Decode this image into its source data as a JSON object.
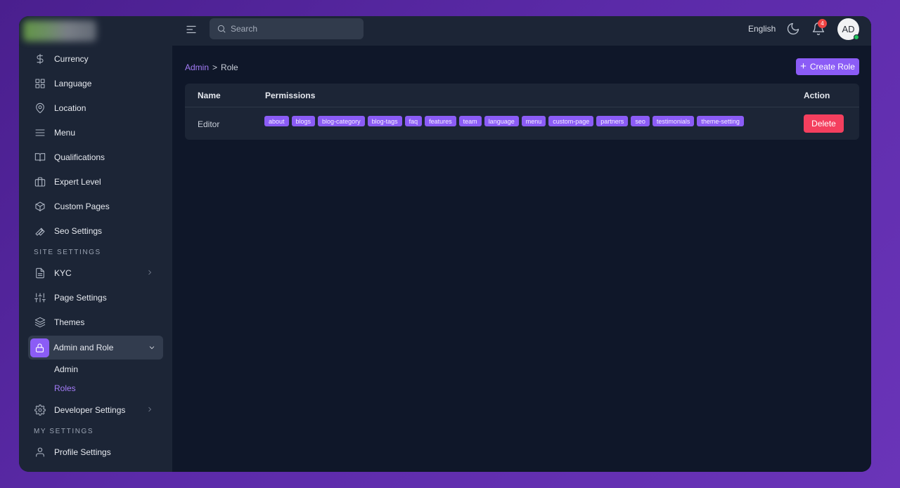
{
  "sidebar": {
    "items": [
      {
        "label": "Currency",
        "icon": "dollar-icon"
      },
      {
        "label": "Language",
        "icon": "grid-icon"
      },
      {
        "label": "Location",
        "icon": "map-pin-icon"
      },
      {
        "label": "Menu",
        "icon": "menu-icon"
      },
      {
        "label": "Qualifications",
        "icon": "book-icon"
      },
      {
        "label": "Expert Level",
        "icon": "briefcase-icon"
      },
      {
        "label": "Custom Pages",
        "icon": "box-icon"
      },
      {
        "label": "Seo Settings",
        "icon": "wrench-icon"
      }
    ],
    "site_settings_title": "SITE SETTINGS",
    "site_items": [
      {
        "label": "KYC",
        "icon": "file-icon"
      },
      {
        "label": "Page Settings",
        "icon": "sliders-icon"
      },
      {
        "label": "Themes",
        "icon": "layers-icon"
      }
    ],
    "admin_role": {
      "label": "Admin and Role",
      "icon": "lock-icon",
      "expanded": true
    },
    "admin_sub": [
      {
        "label": "Admin"
      },
      {
        "label": "Roles"
      }
    ],
    "developer": {
      "label": "Developer Settings",
      "icon": "gear-icon"
    },
    "my_settings_title": "MY SETTINGS",
    "profile": {
      "label": "Profile Settings",
      "icon": "user-icon"
    }
  },
  "topbar": {
    "search_placeholder": "Search",
    "language": "English",
    "notification_count": "4",
    "avatar_initials": "AD"
  },
  "breadcrumb": {
    "parent": "Admin",
    "separator": ">",
    "current": "Role"
  },
  "create_button": "Create Role",
  "table": {
    "headers": {
      "name": "Name",
      "permissions": "Permissions",
      "action": "Action"
    },
    "rows": [
      {
        "name": "Editor",
        "permissions": [
          "about",
          "blogs",
          "blog-category",
          "blog-tags",
          "faq",
          "features",
          "team",
          "language",
          "menu",
          "custom-page",
          "partners",
          "seo",
          "testimonials",
          "theme-setting"
        ],
        "action": "Delete"
      }
    ]
  },
  "colors": {
    "accent": "#8b5cf6",
    "danger": "#f43f5e",
    "background": "#0f1729",
    "panel": "#1c2536"
  }
}
